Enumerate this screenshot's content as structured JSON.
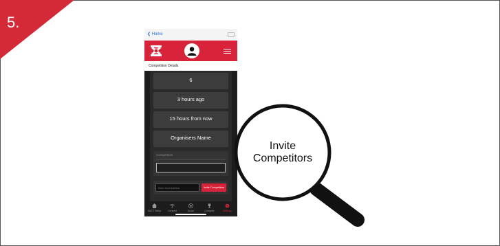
{
  "step": {
    "number": "5."
  },
  "phone": {
    "back_label": "Home",
    "section_title": "Competition Details",
    "cards": [
      {
        "value": "6",
        "sub": ""
      },
      {
        "value": "3 hours ago",
        "sub": ""
      },
      {
        "value": "15 hours from now",
        "sub": ""
      },
      {
        "value": "Organisers Name",
        "sub": ""
      }
    ],
    "competitors_label": "Competitors",
    "competitors_placeholder": "",
    "email_placeholder": "Enter email address",
    "invite_button": "Invite Competitors",
    "tabs": [
      {
        "label": "ISATT Setup",
        "icon": "home-icon"
      },
      {
        "label": "Connect",
        "icon": "wifi-icon"
      },
      {
        "label": "Score",
        "icon": "target-icon"
      },
      {
        "label": "Compete",
        "icon": "trophy-icon"
      },
      {
        "label": "Settings",
        "icon": "gear-icon",
        "active": true
      }
    ]
  },
  "callout": {
    "line1": "Invite",
    "line2": "Competitors"
  },
  "colors": {
    "accent": "#d8243a",
    "dark": "#1c1c1c"
  }
}
